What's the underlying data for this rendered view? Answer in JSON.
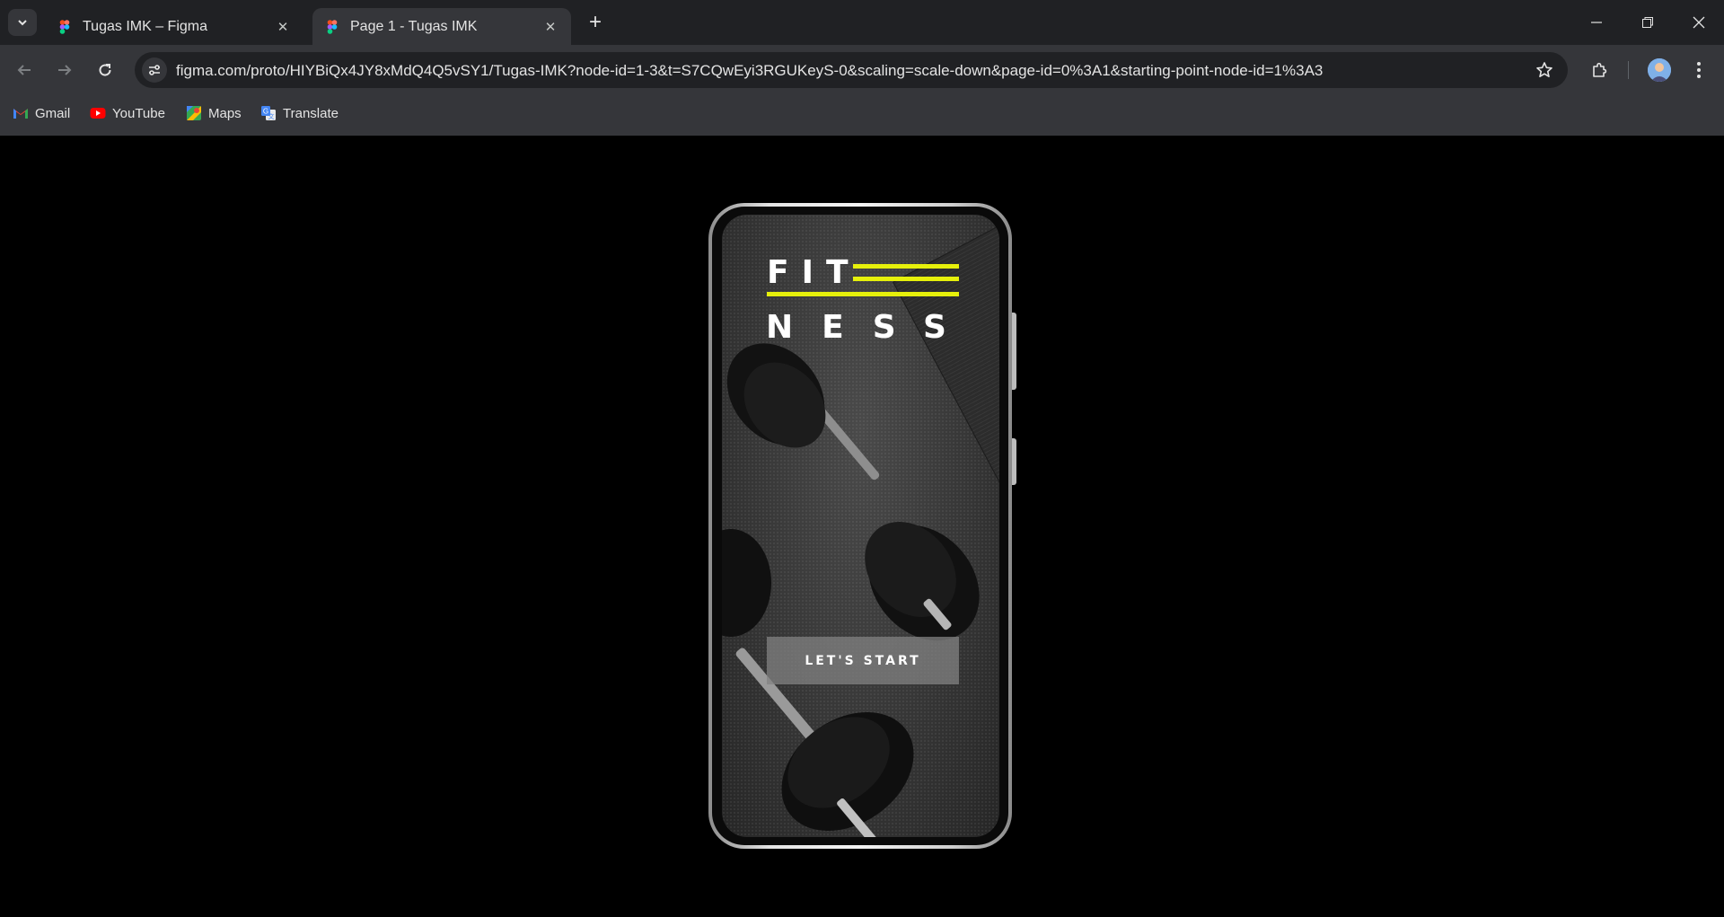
{
  "tabs": [
    {
      "title": "Tugas IMK – Figma",
      "active": false
    },
    {
      "title": "Page 1 - Tugas IMK",
      "active": true
    }
  ],
  "toolbar": {
    "url": "figma.com/proto/HIYBiQx4JY8xMdQ4Q5vSY1/Tugas-IMK?node-id=1-3&t=S7CQwEyi3RGUKeyS-0&scaling=scale-down&page-id=0%3A1&starting-point-node-id=1%3A3"
  },
  "bookmarks": [
    {
      "label": "Gmail",
      "icon": "gmail-icon"
    },
    {
      "label": "YouTube",
      "icon": "youtube-icon"
    },
    {
      "label": "Maps",
      "icon": "maps-icon"
    },
    {
      "label": "Translate",
      "icon": "translate-icon"
    }
  ],
  "prototype": {
    "logo_line1": "FIT",
    "logo_line2": "NESS",
    "cta_label": "LET'S START",
    "accent_color": "#e6f00b"
  }
}
